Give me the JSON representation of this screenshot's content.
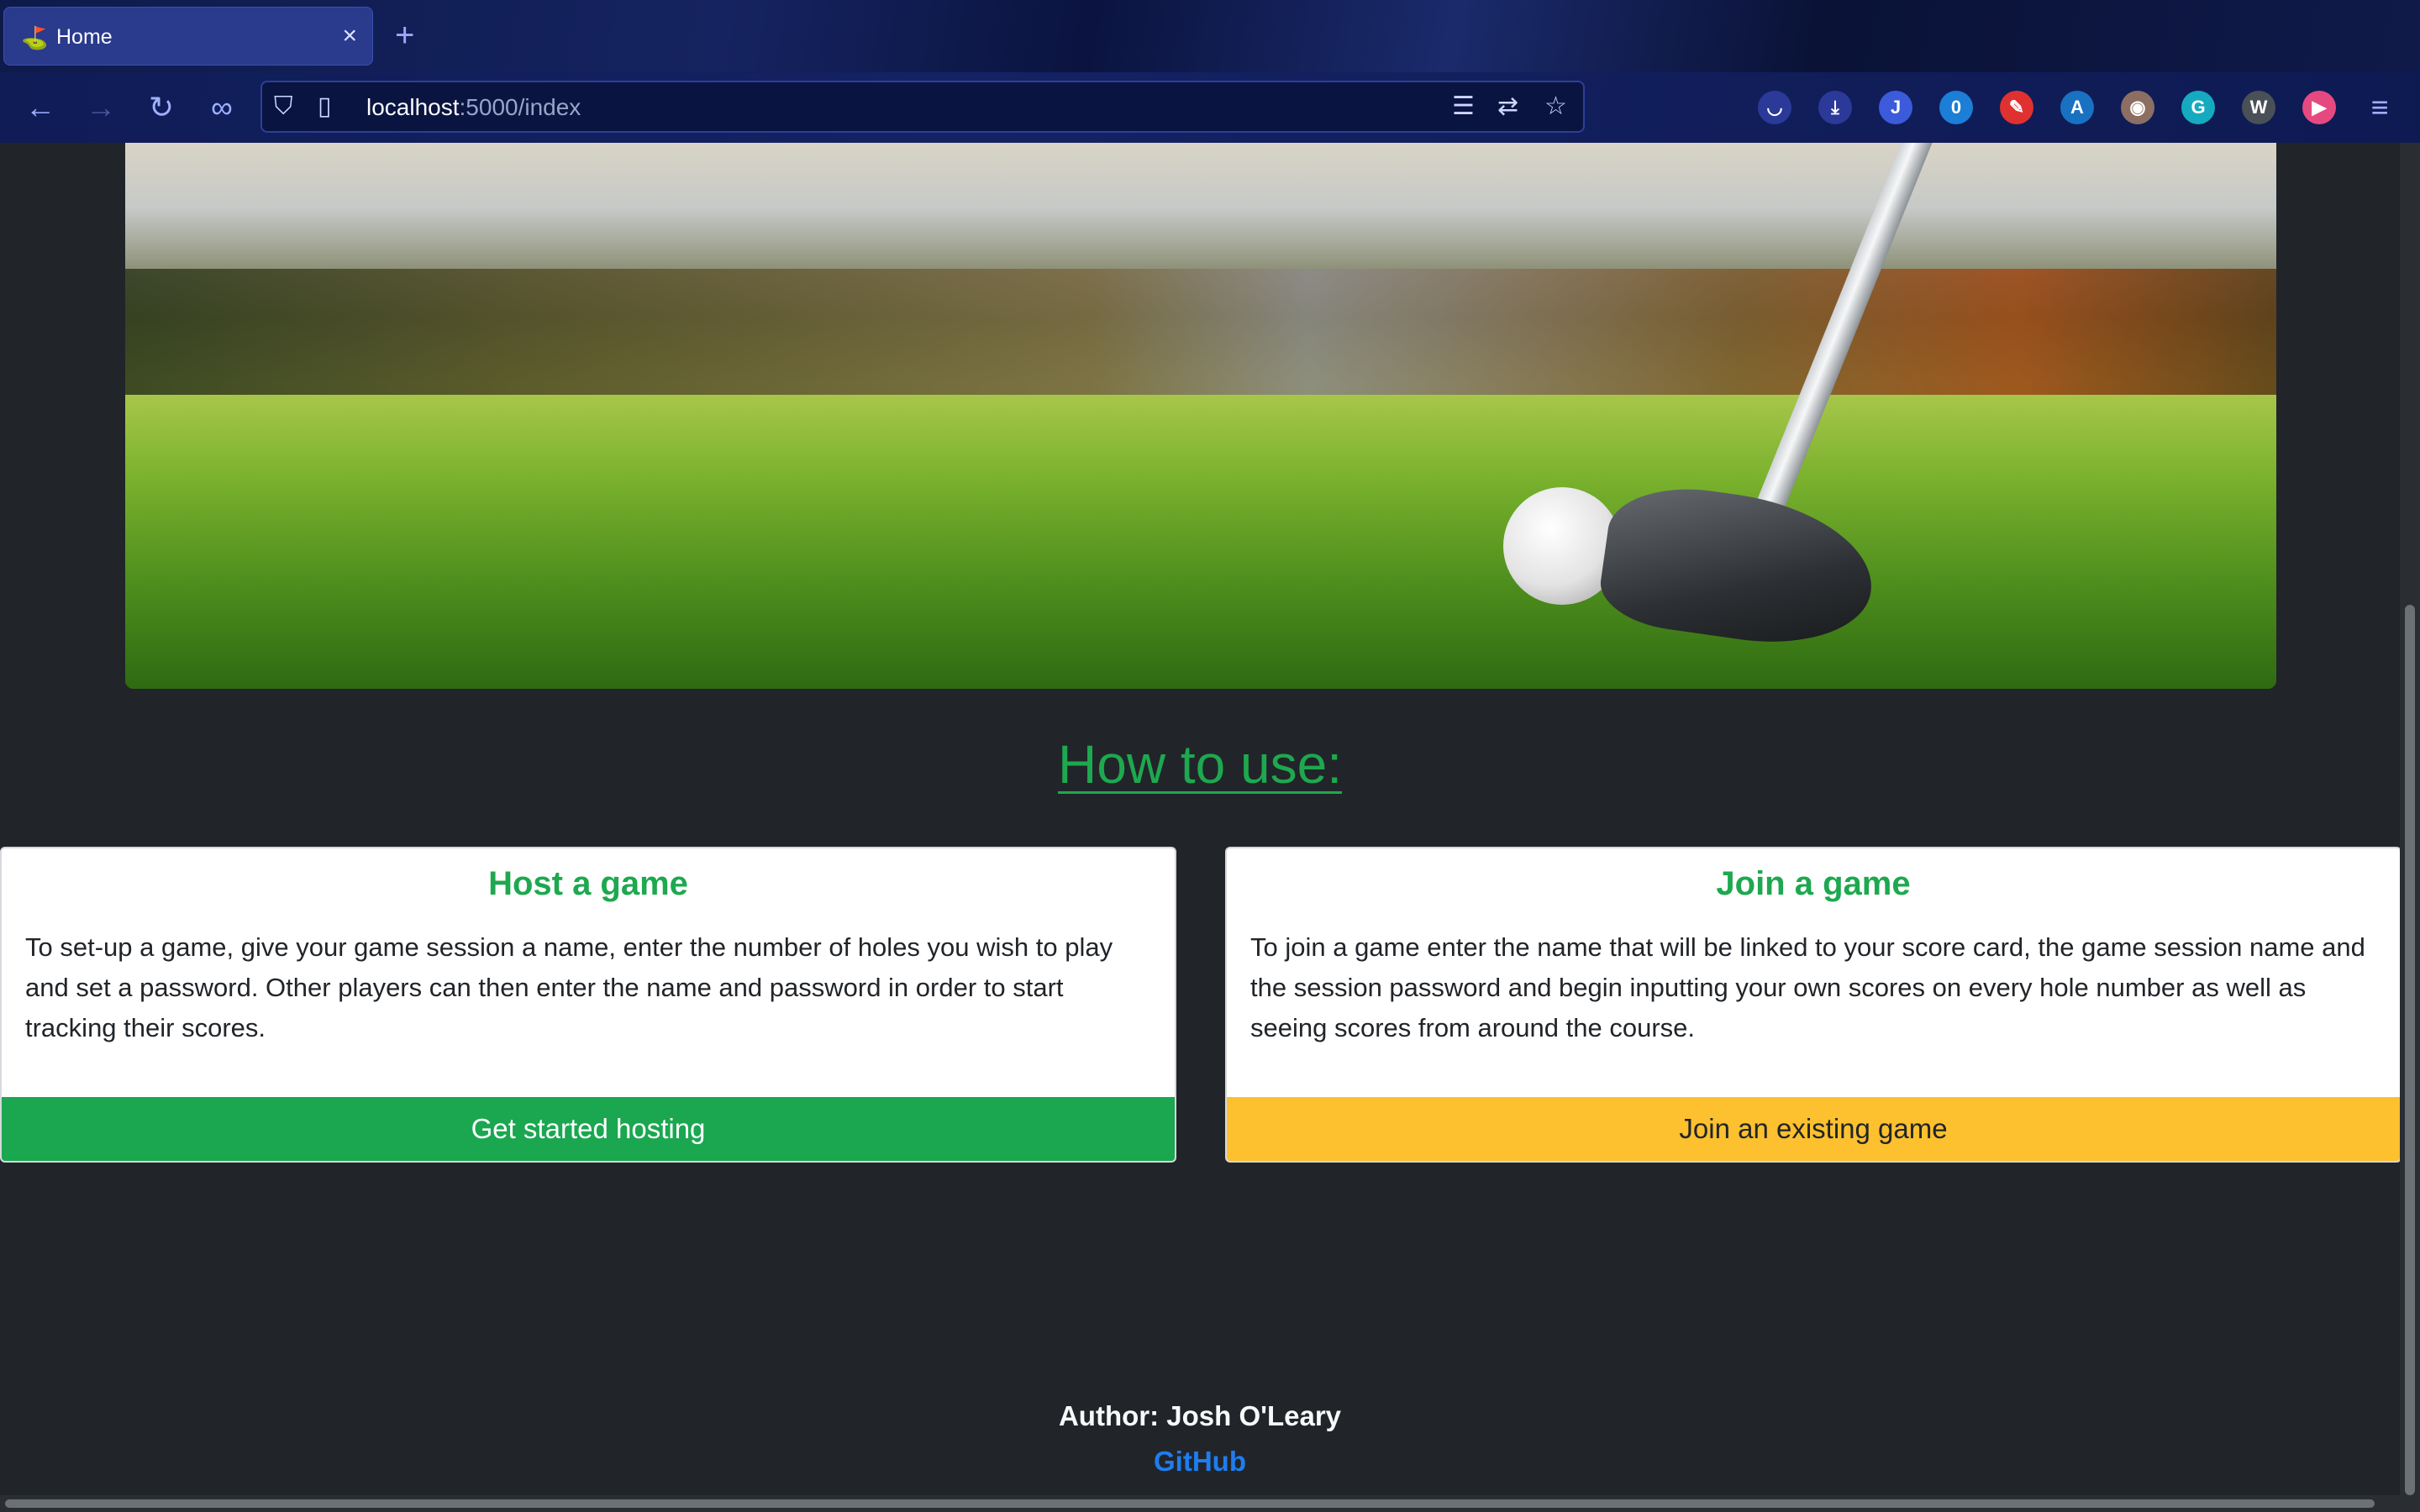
{
  "browser": {
    "tab_title": "Home",
    "tab_favicon": "golf-flag-icon",
    "close_tab_glyph": "×",
    "new_tab_glyph": "+",
    "url_host": "localhost",
    "url_rest": ":5000/index",
    "nav": {
      "back_glyph": "←",
      "forward_glyph": "→",
      "reload_glyph": "↻",
      "mask_glyph": "∞"
    },
    "icons": {
      "shield_glyph": "⛉",
      "page_glyph": "▯",
      "reader_glyph": "☰",
      "translate_glyph": "⇄",
      "bookmark_glyph": "☆",
      "menu_glyph": "≡"
    },
    "extensions": [
      {
        "name": "pocket-icon",
        "glyph": "◡",
        "color": "#2b3a99"
      },
      {
        "name": "downloads-icon",
        "glyph": "⤓",
        "color": "#2b3a99"
      },
      {
        "name": "account-icon",
        "glyph": "J",
        "color": "#3b5bdb"
      },
      {
        "name": "notification-icon",
        "glyph": "0",
        "color": "#1c7ed6"
      },
      {
        "name": "pen-icon",
        "glyph": "✎",
        "color": "#e03131"
      },
      {
        "name": "translate-extension-icon",
        "glyph": "A",
        "color": "#1971c2"
      },
      {
        "name": "cookie-icon",
        "glyph": "◉",
        "color": "#8d6e63"
      },
      {
        "name": "grammarly-icon",
        "glyph": "G",
        "color": "#15aabf"
      },
      {
        "name": "w-extension-icon",
        "glyph": "W",
        "color": "#495057"
      },
      {
        "name": "media-player-icon",
        "glyph": "▶",
        "color": "#e64980"
      }
    ]
  },
  "page": {
    "heading": "How to use:",
    "host_card": {
      "title": "Host a game",
      "text": "To set-up a game, give your game session a name, enter the number of holes you wish to play and set a password. Other players can then enter the name and password in order to start tracking their scores.",
      "button": "Get started hosting"
    },
    "join_card": {
      "title": "Join a game",
      "text": "To join a game enter the name that will be linked to your score card, the game session name and the session password and begin inputting your own scores on every hole number as well as seeing scores from around the course.",
      "button": "Join an existing game"
    },
    "footer": {
      "author": "Author: Josh O'Leary",
      "link": "GitHub"
    }
  },
  "colors": {
    "page_bg": "#212529",
    "accent_green": "#1ea84f",
    "host_button": "#1aa750",
    "join_button": "#fdc02f",
    "link_blue": "#1e7df0"
  }
}
